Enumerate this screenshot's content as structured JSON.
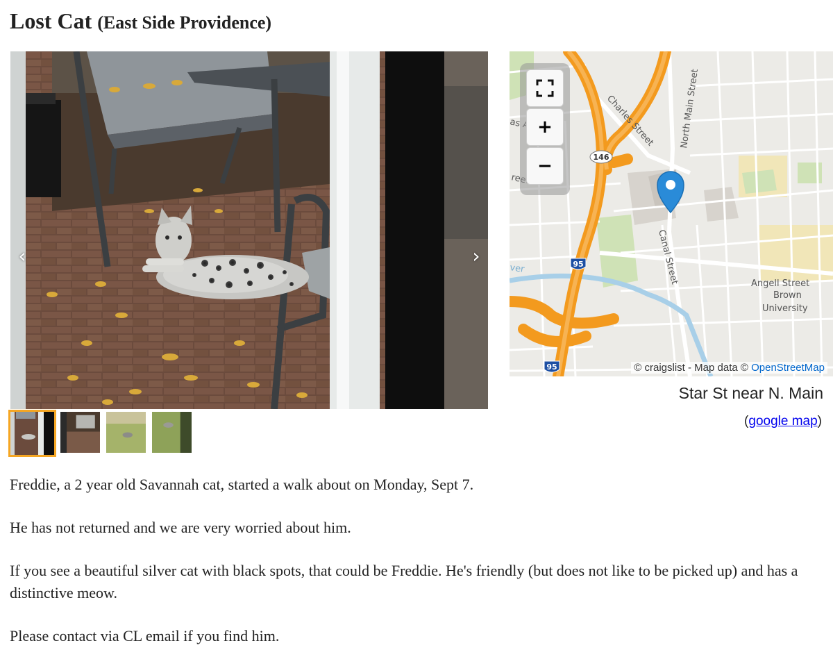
{
  "posting": {
    "title": "Lost Cat",
    "location": "(East Side Providence)"
  },
  "gallery": {
    "prev_icon": "chevron-left-icon",
    "next_icon": "chevron-right-icon",
    "prev_glyph": "‹",
    "next_glyph": "›",
    "thumbnail_count": 4,
    "active_index": 0,
    "active_border_color": "#f5a623"
  },
  "map": {
    "zoom_in_label": "+",
    "zoom_out_label": "−",
    "labels": {
      "charles": "Charles Street",
      "north_main": "North Main Street",
      "canal": "Canal Street",
      "route146": "146",
      "i95_north": "95",
      "i95_south": "95",
      "angell": "Angell Street",
      "brown1": "Brown",
      "brown2": "University",
      "frag_as": "as A",
      "frag_reet": "reet",
      "frag_ver": "ver"
    },
    "attribution_prefix": "© craigslist - Map data © ",
    "attribution_link": "OpenStreetMap",
    "address": "Star St near N. Main",
    "google_open": "(",
    "google_link": "google map",
    "google_close": ")",
    "highway_color": "#f39a1e",
    "marker_color": "#2a8bd8"
  },
  "body": {
    "p1": "Freddie, a 2 year old Savannah cat, started a walk about on Monday, Sept 7.",
    "p2": "He has not returned and we are very worried about him.",
    "p3": "If you see a beautiful silver cat with black spots, that could be Freddie. He's friendly (but does not like to be picked up) and has a distinctive meow.",
    "p4": "Please contact via CL email if you find him."
  }
}
